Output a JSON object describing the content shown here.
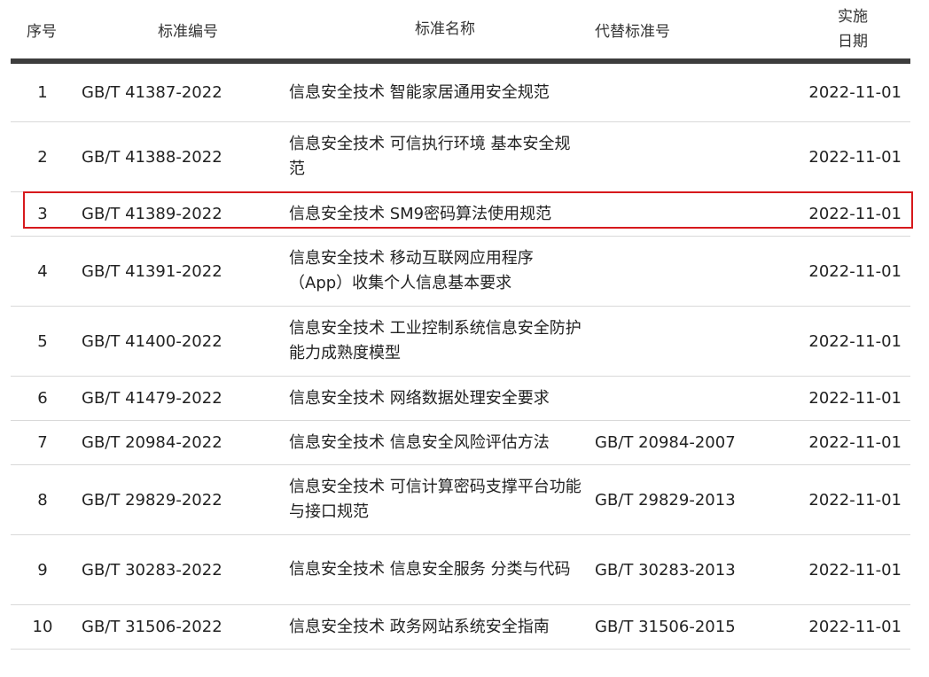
{
  "headers": {
    "no": "序号",
    "code": "标准编号",
    "name": "标准名称",
    "replaces": "代替标准号",
    "date_line1": "实施",
    "date_line2": "日期"
  },
  "rows": [
    {
      "no": "1",
      "code": "GB/T 41387-2022",
      "name": "信息安全技术 智能家居通用安全规范",
      "replaces": "",
      "date": "2022-11-01"
    },
    {
      "no": "2",
      "code": "GB/T 41388-2022",
      "name": "信息安全技术 可信执行环境 基本安全规范",
      "replaces": "",
      "date": "2022-11-01"
    },
    {
      "no": "3",
      "code": "GB/T 41389-2022",
      "name": "信息安全技术 SM9密码算法使用规范",
      "replaces": "",
      "date": "2022-11-01"
    },
    {
      "no": "4",
      "code": "GB/T 41391-2022",
      "name": "信息安全技术 移动互联网应用程序（App）收集个人信息基本要求",
      "replaces": "",
      "date": "2022-11-01"
    },
    {
      "no": "5",
      "code": "GB/T 41400-2022",
      "name": "信息安全技术 工业控制系统信息安全防护能力成熟度模型",
      "replaces": "",
      "date": "2022-11-01"
    },
    {
      "no": "6",
      "code": "GB/T 41479-2022",
      "name": "信息安全技术 网络数据处理安全要求",
      "replaces": "",
      "date": "2022-11-01"
    },
    {
      "no": "7",
      "code": "GB/T 20984-2022",
      "name": "信息安全技术 信息安全风险评估方法",
      "replaces": "GB/T 20984-2007",
      "date": "2022-11-01"
    },
    {
      "no": "8",
      "code": "GB/T 29829-2022",
      "name": "信息安全技术 可信计算密码支撑平台功能与接口规范",
      "replaces": "GB/T 29829-2013",
      "date": "2022-11-01"
    },
    {
      "no": "9",
      "code": "GB/T 30283-2022",
      "name": "信息安全技术 信息安全服务 分类与代码",
      "replaces": "GB/T 30283-2013",
      "date": "2022-11-01"
    },
    {
      "no": "10",
      "code": "GB/T 31506-2022",
      "name": "信息安全技术 政务网站系统安全指南",
      "replaces": "GB/T 31506-2015",
      "date": "2022-11-01"
    }
  ],
  "colors": {
    "highlight_border": "#d7191c",
    "header_bar": "#3d3d3d",
    "row_divider": "#d9d9d9"
  }
}
